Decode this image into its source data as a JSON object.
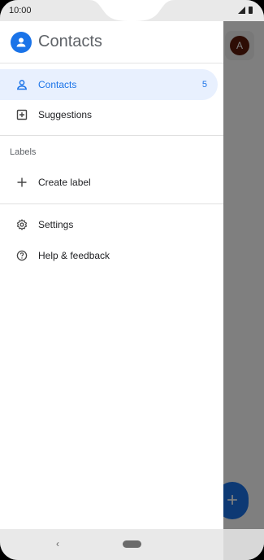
{
  "status": {
    "time": "10:00"
  },
  "background": {
    "avatar_letter": "A",
    "fab_symbol": "+"
  },
  "drawer": {
    "title": "Contacts",
    "items": [
      {
        "label": "Contacts",
        "count": "5"
      },
      {
        "label": "Suggestions"
      }
    ],
    "labels_header": "Labels",
    "create_label": "Create label",
    "settings": "Settings",
    "help": "Help & feedback"
  },
  "navbar": {
    "back_symbol": "‹"
  }
}
